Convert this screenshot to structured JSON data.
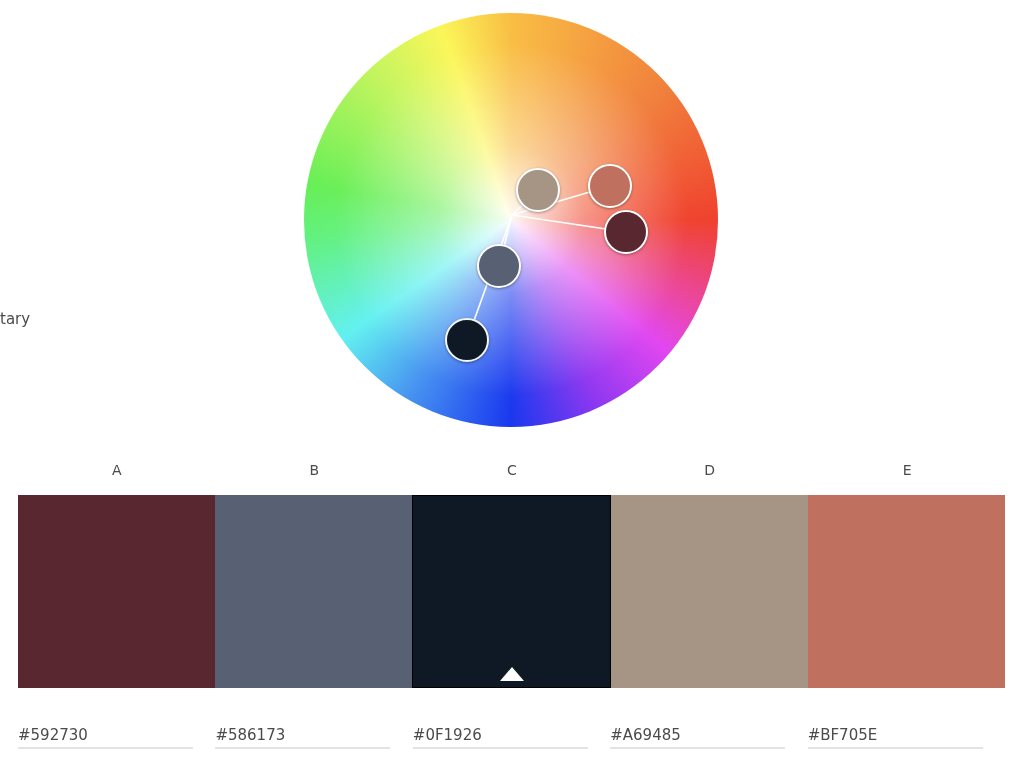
{
  "side_label": "tary",
  "swatches": [
    {
      "letter": "A",
      "color": "#592730",
      "hex": "#592730",
      "selected": false
    },
    {
      "letter": "B",
      "color": "#586173",
      "hex": "#586173",
      "selected": false
    },
    {
      "letter": "C",
      "color": "#0f1926",
      "hex": "#0F1926",
      "selected": true
    },
    {
      "letter": "D",
      "color": "#a69485",
      "hex": "#A69485",
      "selected": false
    },
    {
      "letter": "E",
      "color": "#bf705e",
      "hex": "#BF705E",
      "selected": false
    }
  ]
}
